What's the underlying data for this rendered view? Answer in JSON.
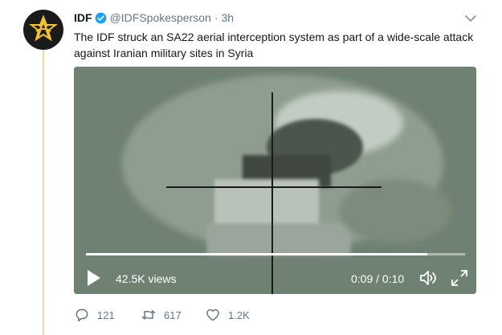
{
  "tweet": {
    "author_name": "IDF",
    "handle": "@IDFSpokesperson",
    "separator": "·",
    "time": "3h",
    "text": "The IDF struck an SA22 aerial interception system as part of a wide-scale attack against Iranian military sites in Syria",
    "verified": true
  },
  "video": {
    "views": "42.5K views",
    "time_display": "0:09 / 0:10",
    "progress_fraction": 0.9
  },
  "actions": {
    "replies": "121",
    "retweets": "617",
    "likes": "1.2K"
  },
  "colors": {
    "accent": "#1da1f2",
    "muted": "#657786",
    "thread_line": "#eddca2",
    "avatar_bg": "#1b1b1b",
    "avatar_emblem": "#f2c230"
  },
  "icons": {
    "avatar": "idf-emblem-icon",
    "verified": "verified-badge-icon",
    "more": "chevron-down-icon",
    "play": "play-icon",
    "volume": "volume-icon",
    "fullscreen": "fullscreen-icon",
    "reply": "reply-icon",
    "retweet": "retweet-icon",
    "like": "heart-icon"
  }
}
